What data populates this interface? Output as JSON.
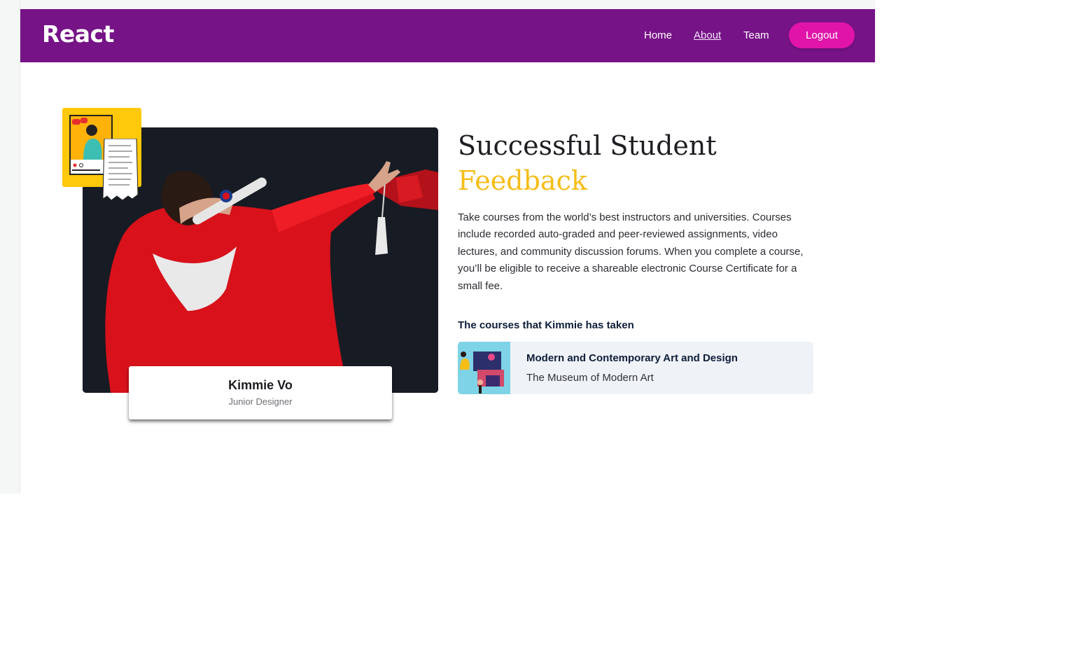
{
  "nav": {
    "brand": "React",
    "links": [
      "Home",
      "About",
      "Team"
    ],
    "active": "About",
    "logout_label": "Logout"
  },
  "profile": {
    "name": "Kimmie Vo",
    "role": "Junior Designer"
  },
  "feedback": {
    "title_line1": "Successful Student",
    "title_line2": "Feedback",
    "description": "Take courses from the world’s best instructors and universities. Courses include recorded auto-graded and peer-reviewed assignments, video lectures, and community discussion forums. When you complete a course, you’ll be eligible to receive a shareable electronic Course Certificate for a small fee.",
    "courses_label": "The courses that Kimmie has taken"
  },
  "courses": [
    {
      "title": "Modern and Contemporary Art and Design",
      "org": "The Museum of Modern Art"
    }
  ],
  "colors": {
    "navbar": "#761387",
    "logout": "#e014a8",
    "accent": "#f6bd17",
    "course_card": "#eff2f7"
  },
  "icons": {
    "photo": "graduate-dabbing-photo",
    "sticker": "social-media-illustration",
    "course_thumb": "art-course-illustration"
  }
}
